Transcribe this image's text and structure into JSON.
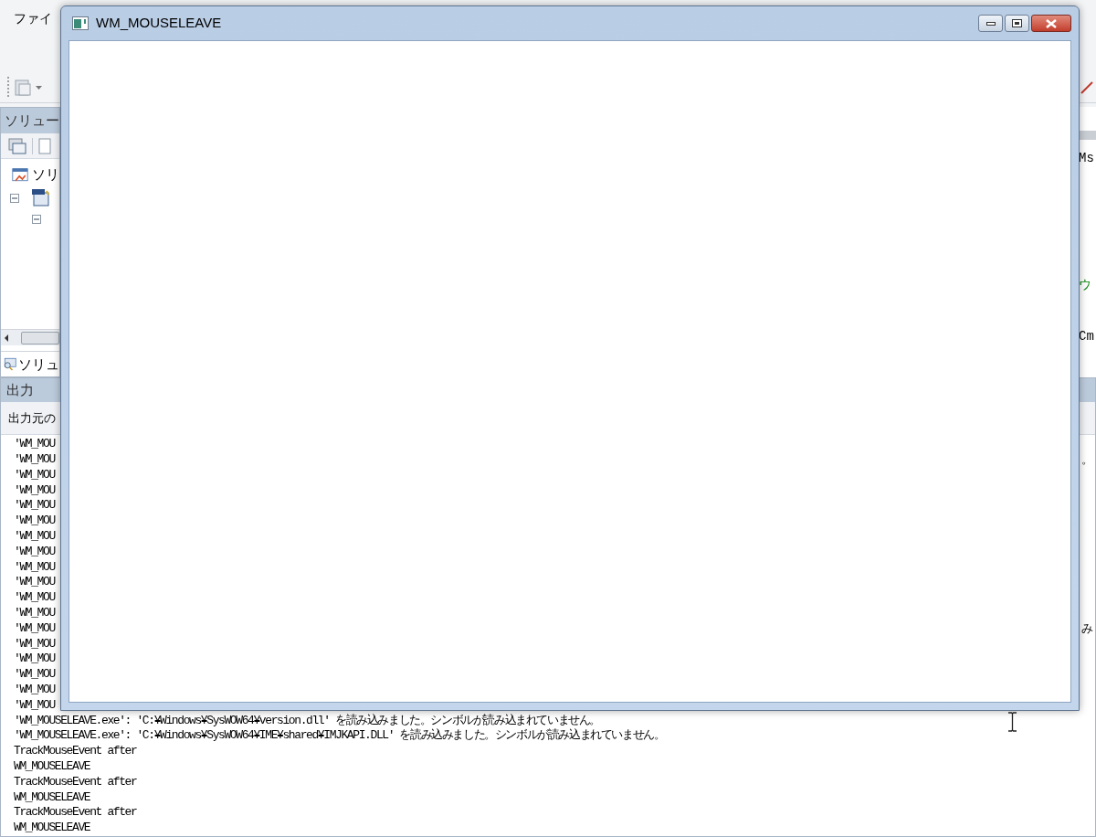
{
  "ide": {
    "menu": [
      {
        "label": "ファイ"
      }
    ],
    "solution_explorer": {
      "title": "ソリュー",
      "tree_root": "ソリ",
      "tab": "ソリュ"
    },
    "right_panel": {
      "texts": [
        {
          "label": "Ms",
          "kind": "code"
        },
        {
          "label": "ウ",
          "kind": "comment"
        },
        {
          "label": "Cm",
          "kind": "code"
        }
      ]
    },
    "output": {
      "title": "出力",
      "source_label": "出力元の",
      "lines": [
        {
          "text": "'WM_MOU"
        },
        {
          "text": "'WM_MOU",
          "tail": "。"
        },
        {
          "text": "'WM_MOU"
        },
        {
          "text": "'WM_MOU"
        },
        {
          "text": "'WM_MOU"
        },
        {
          "text": "'WM_MOU"
        },
        {
          "text": "'WM_MOU"
        },
        {
          "text": "'WM_MOU"
        },
        {
          "text": "'WM_MOU"
        },
        {
          "text": "'WM_MOU"
        },
        {
          "text": "'WM_MOU"
        },
        {
          "text": "'WM_MOU"
        },
        {
          "text": "'WM_MOU",
          "tail": "み"
        },
        {
          "text": "'WM_MOU"
        },
        {
          "text": "'WM_MOU"
        },
        {
          "text": "'WM_MOU"
        },
        {
          "text": "'WM_MOU"
        },
        {
          "text": "'WM_MOU"
        },
        {
          "text": "'WM_MOUSELEAVE.exe': 'C:¥Windows¥SysWOW64¥version.dll' を読み込みました。シンボルが読み込まれていません。"
        },
        {
          "text": "'WM_MOUSELEAVE.exe': 'C:¥Windows¥SysWOW64¥IME¥shared¥IMJKAPI.DLL' を読み込みました。シンボルが読み込まれていません。"
        },
        {
          "text": "TrackMouseEvent after"
        },
        {
          "text": "WM_MOUSELEAVE"
        },
        {
          "text": "TrackMouseEvent after"
        },
        {
          "text": "WM_MOUSELEAVE"
        },
        {
          "text": "TrackMouseEvent after"
        },
        {
          "text": "WM_MOUSELEAVE"
        }
      ]
    }
  },
  "window": {
    "title": "WM_MOUSELEAVE"
  }
}
